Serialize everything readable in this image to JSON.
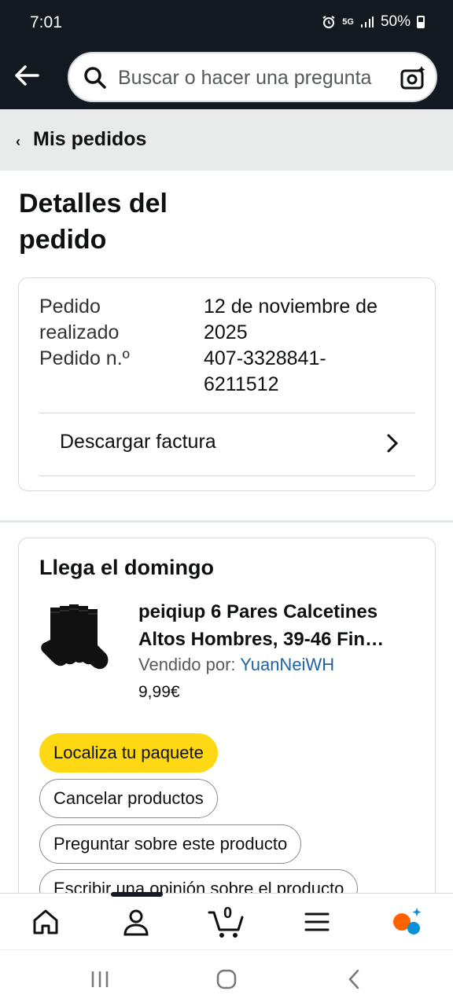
{
  "status": {
    "time": "7:01",
    "network": "5G",
    "battery": "50%"
  },
  "search": {
    "placeholder": "Buscar o hacer una pregunta"
  },
  "breadcrumb": {
    "label": "Mis pedidos"
  },
  "page": {
    "title": "Detalles del pedido"
  },
  "order": {
    "placed_label": "Pedido realizado",
    "placed_value": "12 de noviembre de 2025",
    "number_label": "Pedido n.º",
    "number_value": "407-3328841-6211512",
    "invoice_label": "Descargar factura"
  },
  "shipment": {
    "arrival": "Llega el domingo",
    "product_title": "peiqiup 6 Pares Calcetines Altos Hombres, 39-46 Fin…",
    "sold_by_label": "Vendido por:",
    "seller": "YuanNeiWH",
    "price": "9,99€",
    "buttons": {
      "track": "Localiza tu paquete",
      "cancel": "Cancelar productos",
      "ask": "Preguntar sobre este producto",
      "review": "Escribir una opinión sobre el producto"
    }
  },
  "bottom_nav": {
    "cart_count": "0"
  },
  "colors": {
    "header": "#131921",
    "primary_button": "#ffd814",
    "link": "#2162a1"
  }
}
